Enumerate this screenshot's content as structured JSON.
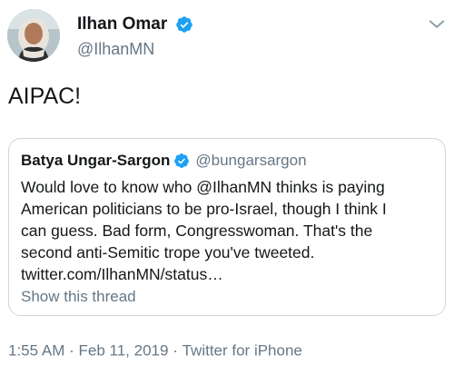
{
  "author": {
    "display_name": "Ilhan Omar",
    "handle": "@IlhanMN",
    "verified": true,
    "avatar_icon": "avatar-photo"
  },
  "tweet_text": "AIPAC!",
  "quoted_tweet": {
    "display_name": "Batya Ungar-Sargon",
    "handle": "@bungarsargon",
    "verified": true,
    "lines": [
      "Would love to know who @IlhanMN thinks is paying",
      "American politicians to be pro-Israel, though I think I",
      "can guess. Bad form, Congresswoman. That's the",
      "second anti-Semitic trope you've tweeted.",
      "twitter.com/IlhanMN/status…"
    ],
    "show_thread_label": "Show this thread"
  },
  "meta": {
    "time": "1:55 AM",
    "separator": "·",
    "date": "Feb 11, 2019",
    "source": "Twitter for iPhone"
  },
  "colors": {
    "text": "#14171a",
    "secondary": "#657786",
    "verified_blue": "#1da1f2",
    "border": "#ccd6dd"
  },
  "icons": {
    "verified": "verified-badge-icon",
    "caret": "chevron-down-icon"
  }
}
